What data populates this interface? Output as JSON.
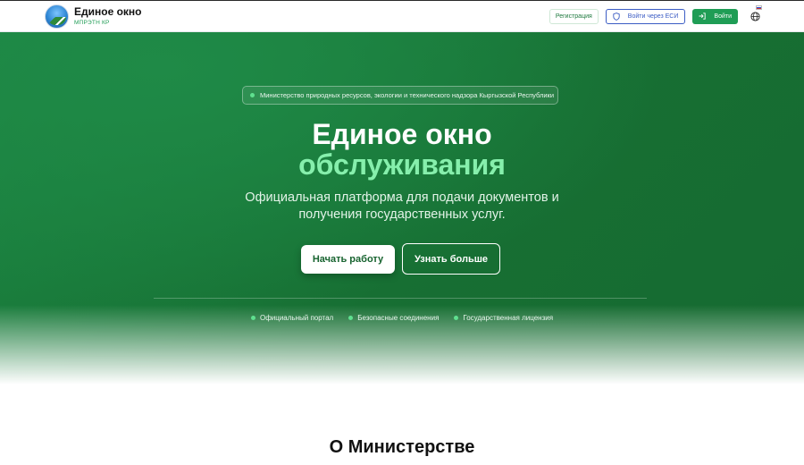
{
  "header": {
    "brand_title": "Единое окно",
    "brand_subtitle": "МПРЭТН КР",
    "register_label": "Регистрация",
    "esi_label": "Войти через ЕСИ",
    "login_label": "Войти",
    "accent": "#1f9d55"
  },
  "hero": {
    "ministry_pill": "Министерство природных ресурсов, экологии и технического надзора Кыргызской Республики",
    "title_line1": "Единое окно",
    "title_line2": "обслуживания",
    "lead": "Официальная платформа для подачи документов и получения государственных услуг.",
    "start_button": "Начать работу",
    "more_button": "Узнать больше",
    "features": [
      "Официальный портал",
      "Безопасные соединения",
      "Государственная лицензия"
    ]
  },
  "about": {
    "title": "О Министерстве"
  }
}
